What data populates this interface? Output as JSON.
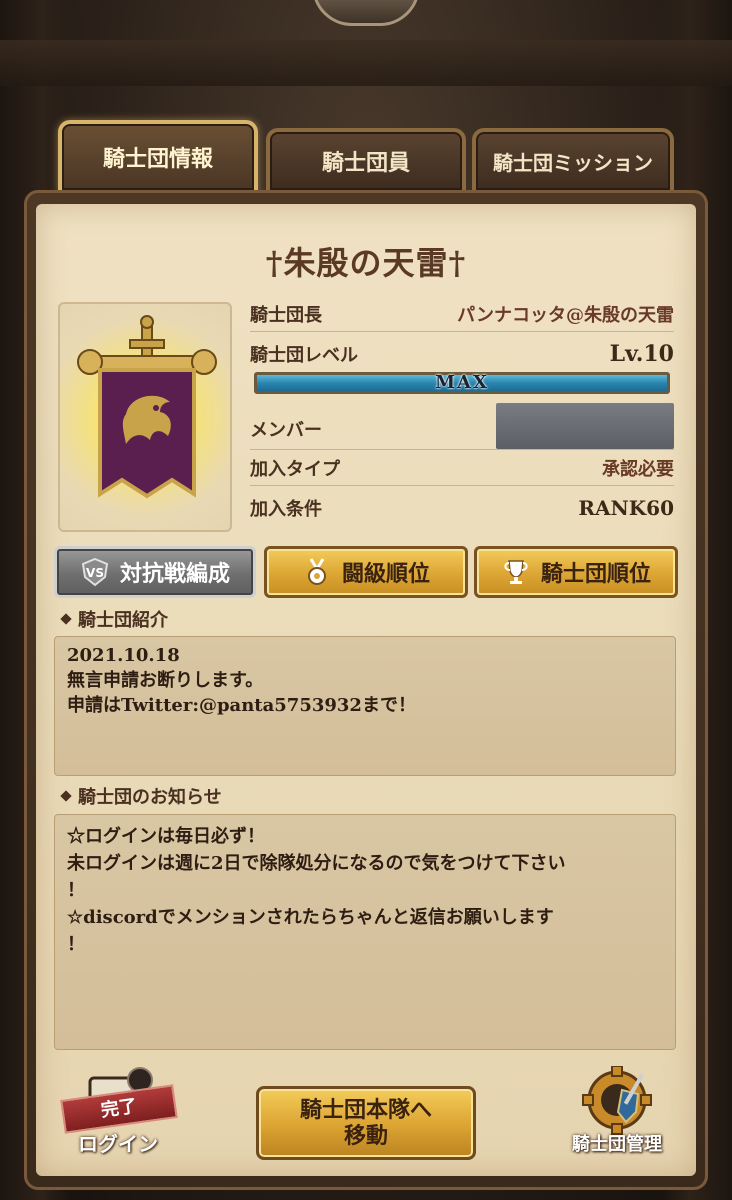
{
  "tabs": [
    {
      "label": "騎士団情報",
      "active": true
    },
    {
      "label": "騎士団員",
      "active": false
    },
    {
      "label": "騎士団ミッション",
      "active": false
    }
  ],
  "guild": {
    "name": "†朱殷の天雷†",
    "leader_label": "騎士団長",
    "leader_value": "パンナコッタ@朱殷の天雷",
    "level_label": "騎士団レベル",
    "level_value": "Lv.10",
    "level_bar_label": "MAX",
    "level_progress": 1.0,
    "member_label": "メンバー",
    "join_type_label": "加入タイプ",
    "join_type_value": "承認必要",
    "join_cond_label": "加入条件",
    "join_cond_value": "RANK60"
  },
  "buttons": {
    "battle": "対抗戦編成",
    "rank": "闘級順位",
    "guild_rank": "騎士団順位"
  },
  "intro": {
    "title": "騎士団紹介",
    "text": "2021.10.18\n無言申請お断りします。\n申請はTwitter:@panta5753932まで！"
  },
  "notice": {
    "title": "騎士団のお知らせ",
    "text": "☆ログインは毎日必ず！\n未ログインは週に2日で除隊処分になるので気をつけて下さい\n！\n☆discordでメンションされたらちゃんと返信お願いします\n！"
  },
  "bottom": {
    "login_done": "完了",
    "login_label": "ログイン",
    "move_line1": "騎士団本隊へ",
    "move_line2": "移動",
    "manage_label": "騎士団管理"
  },
  "colors": {
    "accent_gold": "#dca534",
    "parchment": "#eadbb9",
    "level_bar": "#2a86b0",
    "banner_purple": "#5a1f4e"
  }
}
